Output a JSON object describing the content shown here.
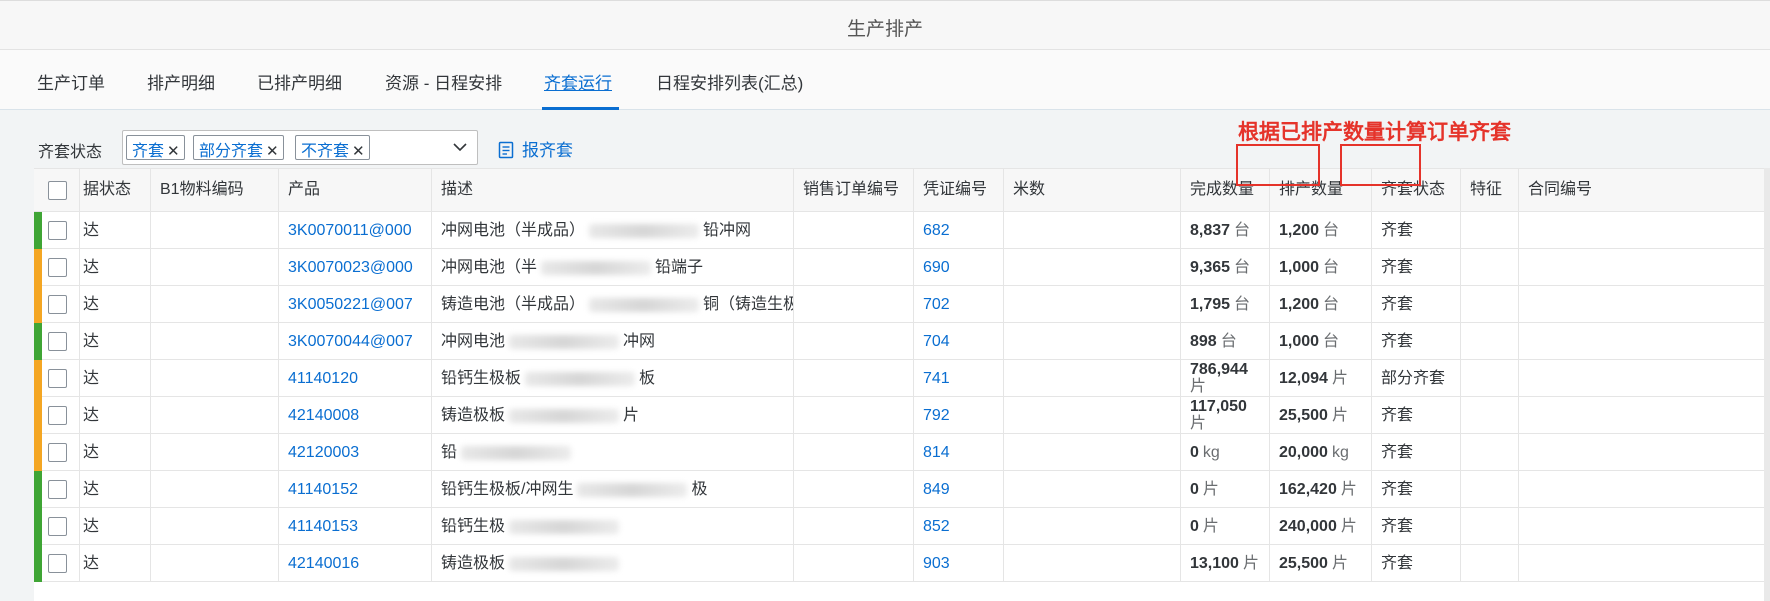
{
  "app": {
    "title": "生产排产"
  },
  "tabs": [
    {
      "label": "生产订单"
    },
    {
      "label": "排产明细"
    },
    {
      "label": "已排产明细"
    },
    {
      "label": "资源 - 日程安排"
    },
    {
      "label": "齐套运行",
      "active": true
    },
    {
      "label": "日程安排列表(汇总)"
    }
  ],
  "filter": {
    "label": "齐套状态",
    "tokens": [
      "齐套",
      "部分齐套",
      "不齐套"
    ],
    "token_remove_glyph": "✕",
    "report_button": "报齐套"
  },
  "annotation": "根据已排产数量计算订单齐套",
  "table": {
    "columns": [
      "据状态",
      "B1物料编码",
      "产品",
      "描述",
      "销售订单编号",
      "凭证编号",
      "米数",
      "完成数量",
      "排产数量",
      "齐套状态",
      "特征",
      "合同编号"
    ],
    "rows": [
      {
        "status_color": "#3fa535",
        "status": "达",
        "product": "3K0070011@000",
        "desc_a": "冲网电池（半成品）",
        "desc_b": "铅冲网",
        "voucher": "682",
        "done": "8,837",
        "done_unit": "台",
        "sched": "1,200",
        "sched_unit": "台",
        "kit": "齐套"
      },
      {
        "status_color": "#f4a623",
        "status": "达",
        "product": "3K0070023@000",
        "desc_a": "冲网电池（半",
        "desc_b": "铅端子",
        "voucher": "690",
        "done": "9,365",
        "done_unit": "台",
        "sched": "1,000",
        "sched_unit": "台",
        "kit": "齐套"
      },
      {
        "status_color": "#f4a623",
        "status": "达",
        "product": "3K0050221@007",
        "desc_a": "铸造电池（半成品）",
        "desc_b": "铜（铸造生极板）",
        "voucher": "702",
        "done": "1,795",
        "done_unit": "台",
        "sched": "1,200",
        "sched_unit": "台",
        "kit": "齐套"
      },
      {
        "status_color": "#3fa535",
        "status": "达",
        "product": "3K0070044@007",
        "desc_a": "冲网电池",
        "desc_b": "冲网",
        "voucher": "704",
        "done": "898",
        "done_unit": "台",
        "sched": "1,000",
        "sched_unit": "台",
        "kit": "齐套"
      },
      {
        "status_color": "#f4a623",
        "status": "达",
        "product": "41140120",
        "desc_a": "铅钙生极板",
        "desc_b": "板",
        "voucher": "741",
        "done": "786,944",
        "done_unit": "片",
        "sched": "12,094",
        "sched_unit": "片",
        "kit": "部分齐套"
      },
      {
        "status_color": "#f4a623",
        "status": "达",
        "product": "42140008",
        "desc_a": "铸造极板",
        "desc_b": "片",
        "voucher": "792",
        "done": "117,050",
        "done_unit": "片",
        "sched": "25,500",
        "sched_unit": "片",
        "kit": "齐套"
      },
      {
        "status_color": "#f4a623",
        "status": "达",
        "product": "42120003",
        "desc_a": "铅",
        "desc_b": "",
        "voucher": "814",
        "done": "0",
        "done_unit": "kg",
        "sched": "20,000",
        "sched_unit": "kg",
        "kit": "齐套"
      },
      {
        "status_color": "#3fa535",
        "status": "达",
        "product": "41140152",
        "desc_a": "铅钙生极板/冲网生",
        "desc_b": "极",
        "voucher": "849",
        "done": "0",
        "done_unit": "片",
        "sched": "162,420",
        "sched_unit": "片",
        "kit": "齐套"
      },
      {
        "status_color": "#3fa535",
        "status": "达",
        "product": "41140153",
        "desc_a": "铅钙生极",
        "desc_b": "",
        "voucher": "852",
        "done": "0",
        "done_unit": "片",
        "sched": "240,000",
        "sched_unit": "片",
        "kit": "齐套"
      },
      {
        "status_color": "#3fa535",
        "status": "达",
        "product": "42140016",
        "desc_a": "铸造极板",
        "desc_b": "",
        "voucher": "903",
        "done": "13,100",
        "done_unit": "片",
        "sched": "25,500",
        "sched_unit": "片",
        "kit": "齐套"
      }
    ]
  }
}
